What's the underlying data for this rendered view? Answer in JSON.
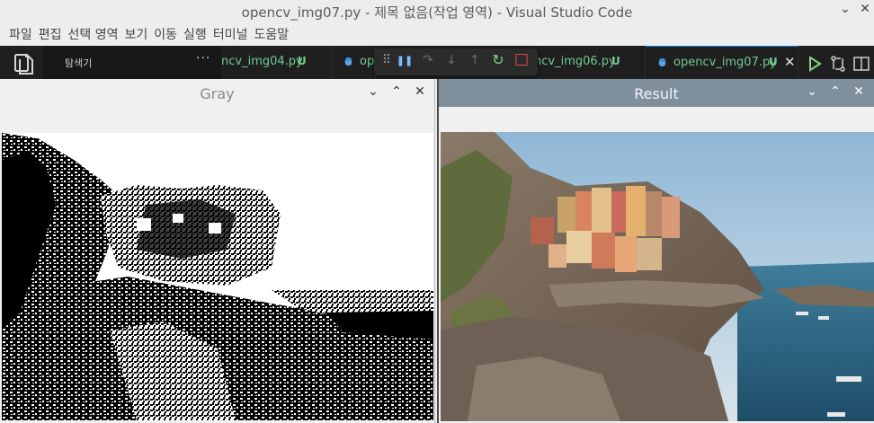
{
  "titlebar": {
    "title": "opencv_img07.py - 제목 없음(작업 영역) - Visual Studio Code",
    "minimize_glyph": "⌄",
    "maximize_glyph": "⌃",
    "close_glyph": "✕"
  },
  "menu": [
    "파일",
    "편집",
    "선택 영역",
    "보기",
    "이동",
    "실행",
    "터미널",
    "도움말"
  ],
  "explorer": {
    "label": "탐색기",
    "more": "···"
  },
  "tabs": [
    {
      "name": "ncv_img04.py",
      "badge": "U"
    },
    {
      "name": "op",
      "badge": ""
    },
    {
      "name": "ncv_img06.py",
      "badge": "U"
    },
    {
      "name": "opencv_img07.py",
      "badge": "U",
      "close": "✕"
    }
  ],
  "debug": {
    "grip": "⠿",
    "pause": "❚❚",
    "step_over": "↷",
    "step_into": "↓",
    "step_out": "↑",
    "restart": "↻",
    "stop": "□"
  },
  "colors": {
    "restart": "#89d185",
    "stop": "#f14c4c",
    "pause": "#75beff",
    "run": "#89d185",
    "modified": "#73c991"
  },
  "windows": {
    "gray": {
      "title": "Gray",
      "chevron": "⌄",
      "up": "⌃",
      "close": "✕"
    },
    "result": {
      "title": "Result",
      "chevron": "⌄",
      "up": "⌃",
      "close": "✕"
    }
  }
}
